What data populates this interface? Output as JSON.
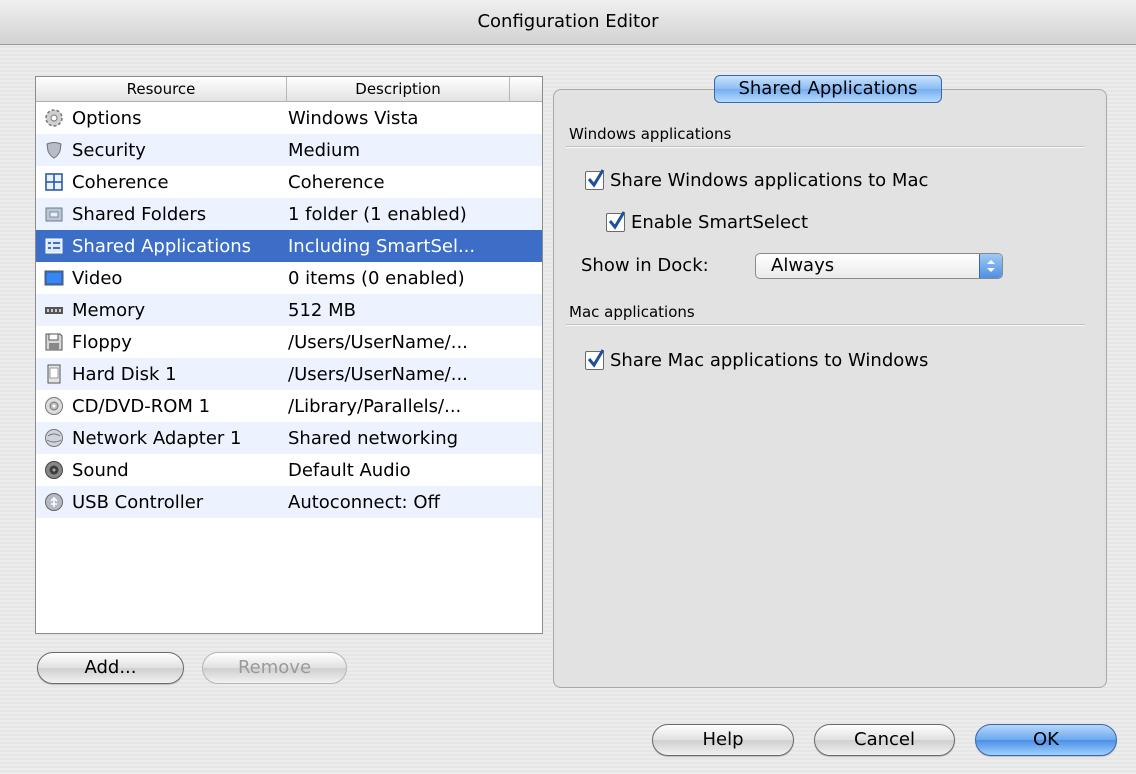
{
  "window": {
    "title": "Configuration Editor"
  },
  "list": {
    "headers": {
      "resource": "Resource",
      "description": "Description"
    },
    "rows": [
      {
        "icon": "gear-icon",
        "resource": "Options",
        "description": "Windows Vista"
      },
      {
        "icon": "shield-icon",
        "resource": "Security",
        "description": "Medium"
      },
      {
        "icon": "coherence-icon",
        "resource": "Coherence",
        "description": "Coherence"
      },
      {
        "icon": "folder-icon",
        "resource": "Shared Folders",
        "description": "1 folder (1 enabled)"
      },
      {
        "icon": "app-list-icon",
        "resource": "Shared Applications",
        "description": "Including SmartSel..."
      },
      {
        "icon": "monitor-icon",
        "resource": "Video",
        "description": "0 items (0 enabled)"
      },
      {
        "icon": "memory-icon",
        "resource": "Memory",
        "description": "512 MB"
      },
      {
        "icon": "floppy-icon",
        "resource": "Floppy",
        "description": "/Users/UserName/..."
      },
      {
        "icon": "hard-disk-icon",
        "resource": "Hard Disk 1",
        "description": "/Users/UserName/..."
      },
      {
        "icon": "cd-icon",
        "resource": "CD/DVD-ROM 1",
        "description": "/Library/Parallels/..."
      },
      {
        "icon": "network-icon",
        "resource": "Network Adapter 1",
        "description": "Shared networking"
      },
      {
        "icon": "speaker-icon",
        "resource": "Sound",
        "description": "Default Audio"
      },
      {
        "icon": "usb-icon",
        "resource": "USB Controller",
        "description": "Autoconnect: Off"
      }
    ],
    "selected_index": 4
  },
  "list_buttons": {
    "add": "Add...",
    "remove": "Remove"
  },
  "panel": {
    "tab_label": "Shared Applications",
    "windows_section": "Windows applications",
    "share_windows_apps": {
      "label": "Share Windows applications to Mac",
      "checked": true
    },
    "enable_smartselect": {
      "label": "Enable SmartSelect",
      "checked": true
    },
    "show_in_dock": {
      "label": "Show in Dock:",
      "value": "Always"
    },
    "mac_section": "Mac applications",
    "share_mac_apps": {
      "label": "Share Mac applications to Windows",
      "checked": true
    }
  },
  "footer": {
    "help": "Help",
    "cancel": "Cancel",
    "ok": "OK"
  },
  "colors": {
    "selection": "#3c6ec8",
    "accent": "#4c8fe6",
    "checkmark": "#1d4f9a"
  }
}
